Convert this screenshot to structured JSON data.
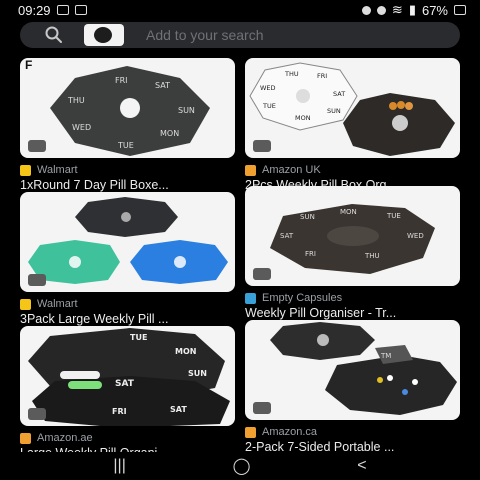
{
  "status": {
    "time": "09:29",
    "battery": "67%"
  },
  "search": {
    "placeholder": "Add to your search"
  },
  "cards": [
    {
      "source": "Walmart",
      "title": "1xRound 7 Day Pill Boxe...",
      "corner": "F",
      "labels": [
        "FRI",
        "SAT",
        "SUN",
        "MON",
        "TUE",
        "WED",
        "THU"
      ]
    },
    {
      "source": "Amazon UK",
      "title": "2Pcs Weekly Pill Box Org...",
      "labels": [
        "THU",
        "FRI",
        "SAT",
        "SUN",
        "MON",
        "TUE",
        "WED"
      ]
    },
    {
      "source": "Walmart",
      "title": "3Pack Large Weekly Pill ...",
      "labels": []
    },
    {
      "source": "Empty Capsules",
      "title": "Weekly Pill Organiser - Tr...",
      "labels": [
        "MON",
        "TUE",
        "WED",
        "THU",
        "FRI",
        "SAT",
        "SUN"
      ]
    },
    {
      "source": "Amazon.ae",
      "title": "Large Weekly Pill Organi...",
      "labels": [
        "TUE",
        "MON",
        "SUN",
        "SAT",
        "FRI",
        "SAT"
      ]
    },
    {
      "source": "Amazon.ca",
      "title": "2-Pack 7-Sided Portable ...",
      "labels": [
        "TM"
      ]
    }
  ],
  "colors": {
    "walmart": "#f5c518",
    "amazon": "#f0a030",
    "capsules": "#3aa0d8"
  },
  "nav": {
    "recents_icon": "recents-icon",
    "home_icon": "home-icon",
    "back_icon": "back-icon"
  }
}
